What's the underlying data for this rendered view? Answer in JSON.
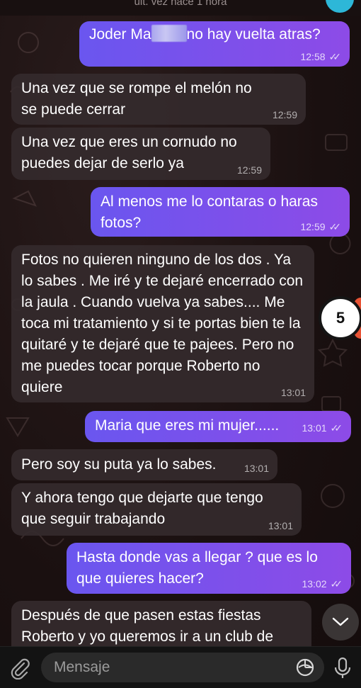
{
  "header": {
    "status": "últ. vez hace 1 hora"
  },
  "messages": [
    {
      "dir": "out",
      "text_before": "Joder Ma",
      "text_after": "no hay vuelta atras?",
      "time": "12:58",
      "read": true
    },
    {
      "dir": "in",
      "text": "Una vez que se rompe el melón no se puede cerrar",
      "time": "12:59"
    },
    {
      "dir": "in",
      "text": "Una vez que eres un cornudo no puedes dejar de serlo ya",
      "time": "12:59"
    },
    {
      "dir": "out",
      "text": "Al menos me lo contaras o haras fotos?",
      "time": "12:59",
      "read": true
    },
    {
      "dir": "in",
      "text": "Fotos no quieren ninguno de los dos . Ya lo sabes . Me iré y te dejaré encerrado con la jaula . Cuando vuelva ya sabes.... Me toca mi tratamiento y si te portas bien te la quitaré y te dejaré que te pajees. Pero no me puedes tocar porque Roberto no quiere",
      "time": "13:01"
    },
    {
      "dir": "out",
      "text": "Maria que eres mi mujer......",
      "time": "13:01",
      "read": true
    },
    {
      "dir": "in",
      "text": "Pero soy su puta ya lo sabes.",
      "time": "13:01"
    },
    {
      "dir": "in",
      "text": "Y ahora tengo que dejarte que tengo que seguir trabajando",
      "time": "13:01"
    },
    {
      "dir": "out",
      "text": "Hasta donde vas a llegar ? que es lo que quieres hacer?",
      "time": "13:02",
      "read": true
    },
    {
      "dir": "in",
      "text": "Después de que pasen estas fiestas Roberto y yo queremos ir a un club de",
      "time": ""
    }
  ],
  "badge": {
    "count": "5"
  },
  "composer": {
    "placeholder": "Mensaje"
  },
  "icons": {
    "attach": "paperclip-icon",
    "sticker": "sticker-icon",
    "mic": "microphone-icon",
    "scroll": "chevron-down-icon"
  },
  "colors": {
    "outgoing_start": "#6a56ef",
    "outgoing_end": "#8d4be7",
    "incoming": "#342a2c",
    "badge": "#ffffff",
    "badge_accent": "#e85335"
  }
}
